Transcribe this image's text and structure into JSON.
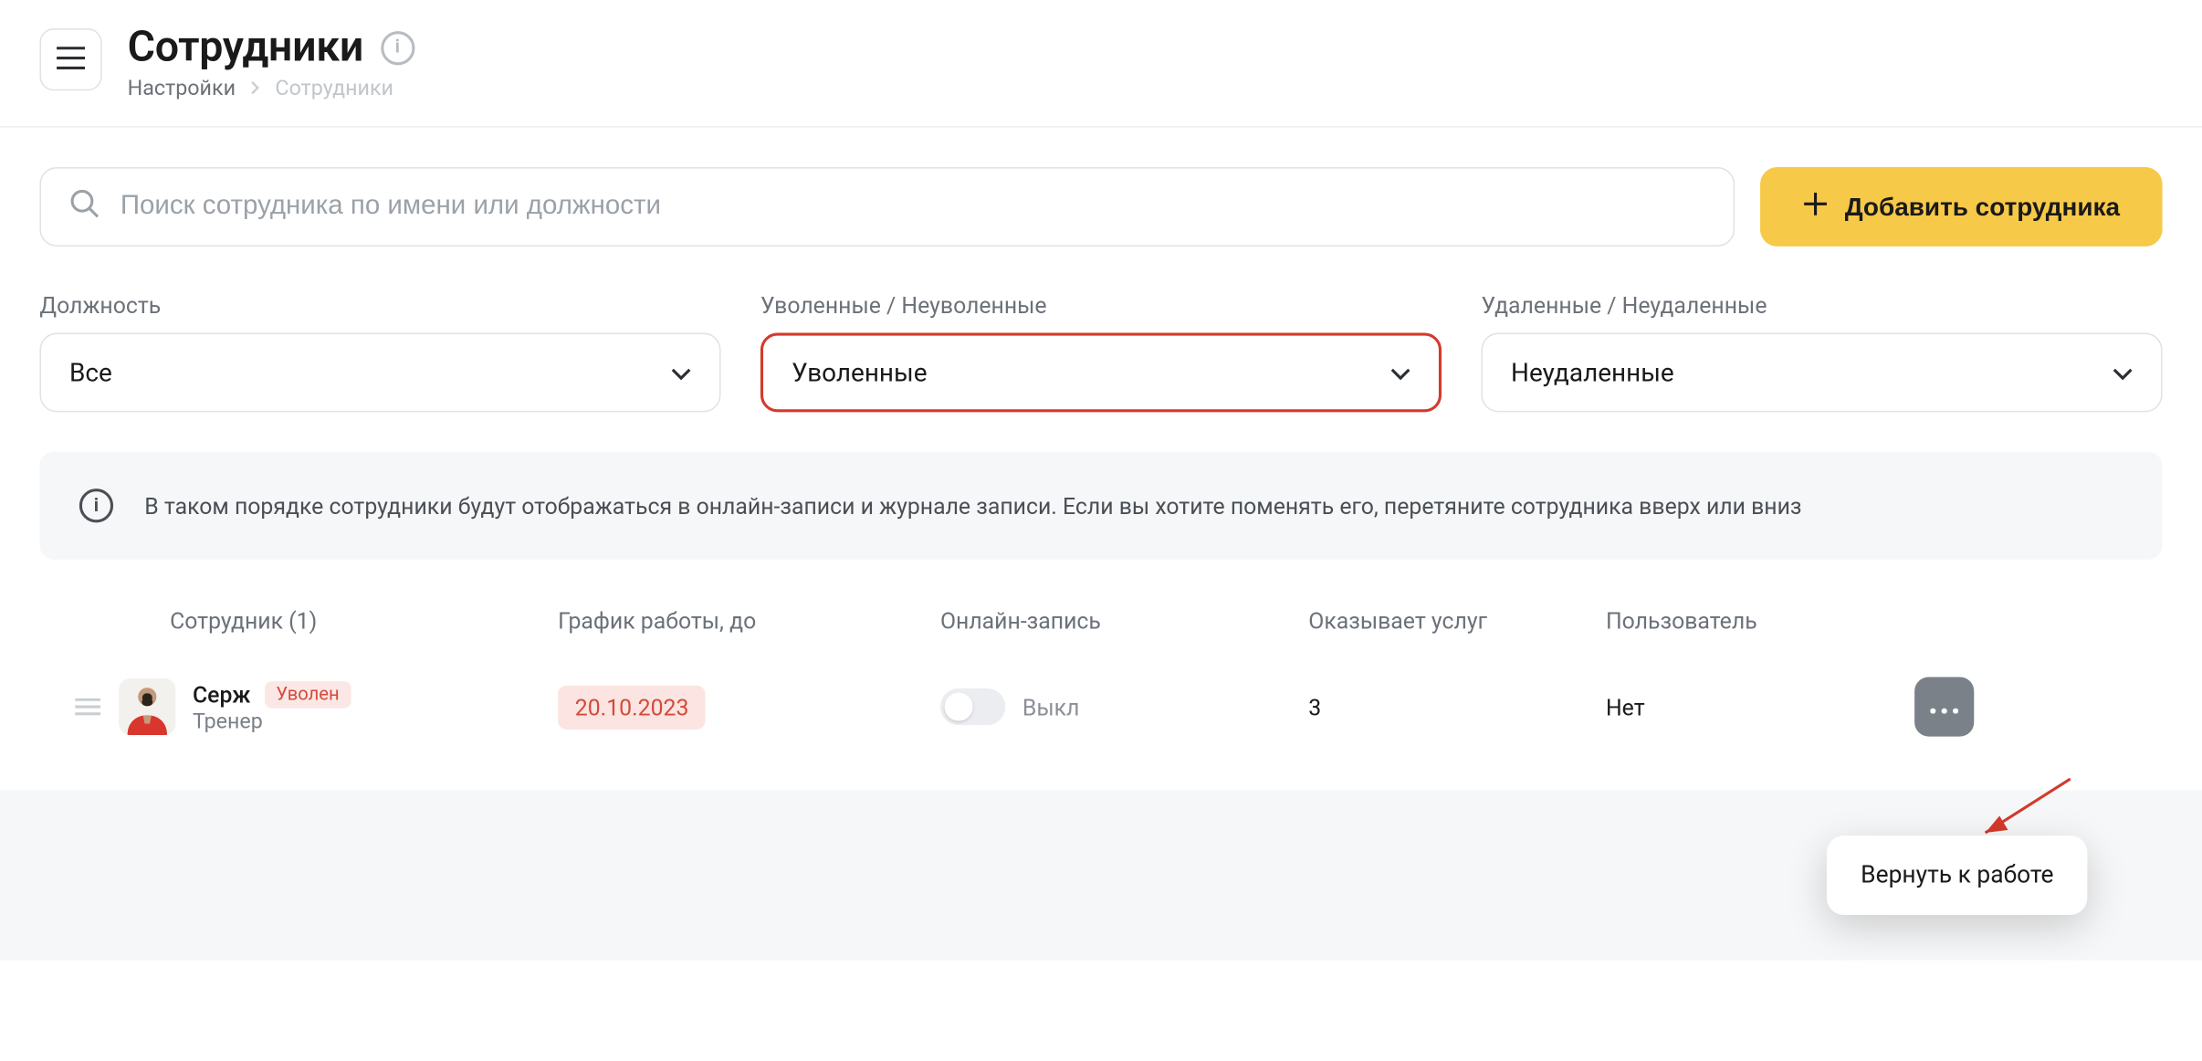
{
  "header": {
    "title": "Сотрудники",
    "breadcrumb_root": "Настройки",
    "breadcrumb_current": "Сотрудники"
  },
  "search": {
    "placeholder": "Поиск сотрудника по имени или должности"
  },
  "add_button": "Добавить сотрудника",
  "filters": {
    "position": {
      "label": "Должность",
      "value": "Все"
    },
    "dismissed": {
      "label": "Уволенные / Неуволенные",
      "value": "Уволенные"
    },
    "deleted": {
      "label": "Удаленные / Неудаленные",
      "value": "Неудаленные"
    }
  },
  "info_banner": "В таком порядке сотрудники будут отображаться в онлайн-записи и журнале записи. Если вы хотите поменять его, перетяните сотрудника вверх или вниз",
  "columns": {
    "employee": "Сотрудник (1)",
    "schedule": "График работы, до",
    "online": "Онлайн-запись",
    "services": "Оказывает услуг",
    "user": "Пользователь"
  },
  "rows": [
    {
      "name": "Серж",
      "role": "Тренер",
      "badge": "Уволен",
      "schedule_until": "20.10.2023",
      "online_toggle_label": "Выкл",
      "services_count": "3",
      "user": "Нет"
    }
  ],
  "popover": {
    "return_to_work": "Вернуть к работе"
  }
}
